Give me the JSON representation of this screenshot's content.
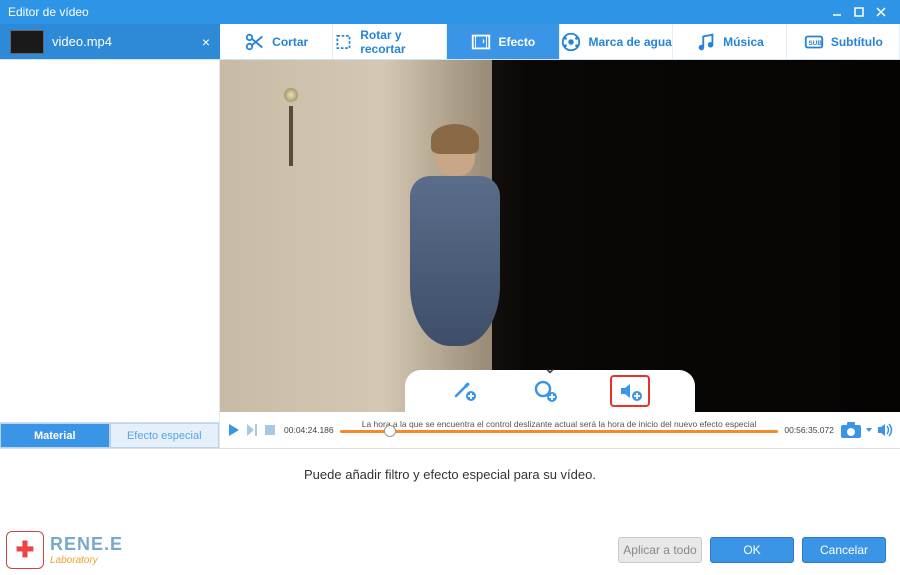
{
  "window": {
    "title": "Editor de vídeo"
  },
  "file": {
    "name": "video.mp4"
  },
  "tools": [
    {
      "id": "cut",
      "label": "Cortar"
    },
    {
      "id": "rotate",
      "label": "Rotar y recortar"
    },
    {
      "id": "effect",
      "label": "Efecto",
      "active": true
    },
    {
      "id": "watermark",
      "label": "Marca de agua"
    },
    {
      "id": "music",
      "label": "Música"
    },
    {
      "id": "subtitle",
      "label": "Subtítulo"
    }
  ],
  "sidebar_tabs": {
    "material": "Material",
    "special": "Efecto especial"
  },
  "bubble_icons": {
    "wand": "add-filter-icon",
    "zoom": "zoom-add-icon",
    "audio": "audio-add-icon"
  },
  "timeline": {
    "current": "00:04:24.186",
    "duration": "00:56:35.072",
    "hint": "La hora a la que se encuentra el control deslizante actual será la hora de inicio del nuevo efecto especial"
  },
  "bottom": {
    "hint": "Puede añadir filtro y efecto especial para su vídeo.",
    "apply_all": "Aplicar a todo",
    "ok": "OK",
    "cancel": "Cancelar"
  },
  "logo": {
    "brand": "RENE.E",
    "sub": "Laboratory"
  },
  "colors": {
    "accent": "#3b95e6",
    "highlight": "#e63528",
    "timeline": "#f58a2a"
  }
}
